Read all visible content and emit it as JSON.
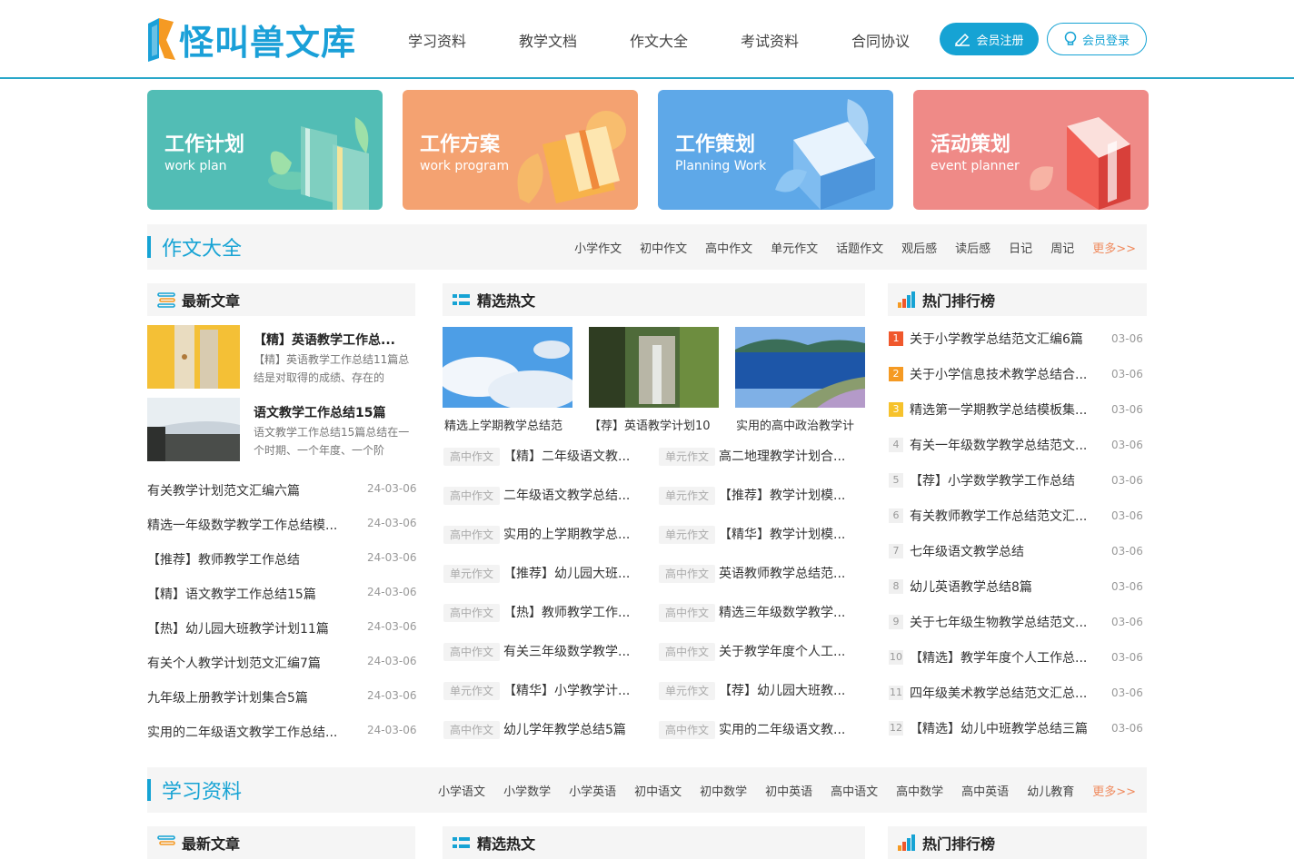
{
  "brand": {
    "name": "怪叫兽文库"
  },
  "nav": [
    "学习资料",
    "教学文档",
    "作文大全",
    "考试资料",
    "合同协议"
  ],
  "auth": {
    "register": "会员注册",
    "login": "会员登录"
  },
  "banners": [
    {
      "title": "工作计划",
      "subtitle": "work plan",
      "color": "#52bdb5"
    },
    {
      "title": "工作方案",
      "subtitle": "work program",
      "color": "#f4a271"
    },
    {
      "title": "工作策划",
      "subtitle": "Planning Work",
      "color": "#5ea8e8"
    },
    {
      "title": "活动策划",
      "subtitle": "event planner",
      "color": "#ef8a87"
    }
  ],
  "section1": {
    "title": "作文大全",
    "links": [
      "小学作文",
      "初中作文",
      "高中作文",
      "单元作文",
      "话题作文",
      "观后感",
      "读后感",
      "日记",
      "周记"
    ],
    "more": "更多>>"
  },
  "section2": {
    "title": "学习资料",
    "links": [
      "小学语文",
      "小学数学",
      "小学英语",
      "初中语文",
      "初中数学",
      "初中英语",
      "高中语文",
      "高中数学",
      "高中英语",
      "幼儿教育"
    ],
    "more": "更多>>"
  },
  "col_titles": {
    "latest": "最新文章",
    "hot": "精选热文",
    "rank": "热门排行榜"
  },
  "latest_featured": [
    {
      "title": "【精】英语教学工作总...",
      "desc": "【精】英语教学工作总结11篇总结是对取得的成绩、存在的"
    },
    {
      "title": "语文教学工作总结15篇",
      "desc": "语文教学工作总结15篇总结在一个时期、一个年度、一个阶"
    }
  ],
  "latest_list": [
    {
      "title": "有关教学计划范文汇编六篇",
      "date": "24-03-06"
    },
    {
      "title": "精选一年级数学教学工作总结模...",
      "date": "24-03-06"
    },
    {
      "title": "【推荐】教师教学工作总结",
      "date": "24-03-06"
    },
    {
      "title": "【精】语文教学工作总结15篇",
      "date": "24-03-06"
    },
    {
      "title": "【热】幼儿园大班教学计划11篇",
      "date": "24-03-06"
    },
    {
      "title": "有关个人教学计划范文汇编7篇",
      "date": "24-03-06"
    },
    {
      "title": "九年级上册教学计划集合5篇",
      "date": "24-03-06"
    },
    {
      "title": "实用的二年级语文教学工作总结...",
      "date": "24-03-06"
    }
  ],
  "hot_pics": [
    "精选上学期教学总结范",
    "【荐】英语教学计划10",
    "实用的高中政治教学计"
  ],
  "hot_rows": [
    [
      {
        "tag": "高中作文",
        "title": "【精】二年级语文教..."
      },
      {
        "tag": "单元作文",
        "title": "高二地理教学计划合..."
      }
    ],
    [
      {
        "tag": "高中作文",
        "title": "二年级语文教学总结..."
      },
      {
        "tag": "单元作文",
        "title": "【推荐】教学计划模..."
      }
    ],
    [
      {
        "tag": "高中作文",
        "title": "实用的上学期教学总..."
      },
      {
        "tag": "单元作文",
        "title": "【精华】教学计划模..."
      }
    ],
    [
      {
        "tag": "单元作文",
        "title": "【推荐】幼儿园大班..."
      },
      {
        "tag": "高中作文",
        "title": "英语教师教学总结范..."
      }
    ],
    [
      {
        "tag": "高中作文",
        "title": "【热】教师教学工作..."
      },
      {
        "tag": "高中作文",
        "title": "精选三年级数学教学..."
      }
    ],
    [
      {
        "tag": "高中作文",
        "title": "有关三年级数学教学..."
      },
      {
        "tag": "高中作文",
        "title": "关于教学年度个人工..."
      }
    ],
    [
      {
        "tag": "单元作文",
        "title": "【精华】小学教学计..."
      },
      {
        "tag": "单元作文",
        "title": "【荐】幼儿园大班教..."
      }
    ],
    [
      {
        "tag": "高中作文",
        "title": "幼儿学年教学总结5篇"
      },
      {
        "tag": "高中作文",
        "title": "实用的二年级语文教..."
      }
    ]
  ],
  "rank": [
    {
      "n": "1",
      "title": "关于小学教学总结范文汇编6篇",
      "date": "03-06"
    },
    {
      "n": "2",
      "title": "关于小学信息技术教学总结合...",
      "date": "03-06"
    },
    {
      "n": "3",
      "title": "精选第一学期教学总结模板集...",
      "date": "03-06"
    },
    {
      "n": "4",
      "title": "有关一年级数学教学总结范文...",
      "date": "03-06"
    },
    {
      "n": "5",
      "title": "【荐】小学数学教学工作总结",
      "date": "03-06"
    },
    {
      "n": "6",
      "title": "有关教师教学工作总结范文汇...",
      "date": "03-06"
    },
    {
      "n": "7",
      "title": "七年级语文教学总结",
      "date": "03-06"
    },
    {
      "n": "8",
      "title": "幼儿英语教学总结8篇",
      "date": "03-06"
    },
    {
      "n": "9",
      "title": "关于七年级生物教学总结范文...",
      "date": "03-06"
    },
    {
      "n": "10",
      "title": "【精选】教学年度个人工作总...",
      "date": "03-06"
    },
    {
      "n": "11",
      "title": "四年级美术教学总结范文汇总...",
      "date": "03-06"
    },
    {
      "n": "12",
      "title": "【精选】幼儿中班教学总结三篇",
      "date": "03-06"
    }
  ],
  "rank_colors": [
    "#f0582c",
    "#f59a23",
    "#f6c22c"
  ]
}
